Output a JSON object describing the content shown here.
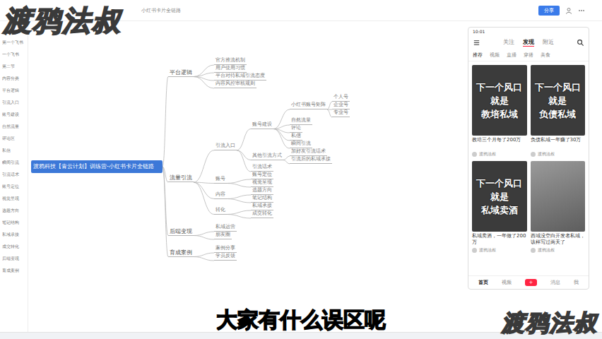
{
  "toolbar": {
    "doc_title": "小红书卡片全链路",
    "share_button": "分享"
  },
  "watermarks": [
    {
      "text": "渡鸦法叔"
    },
    {
      "text": "渡鸦法叔"
    }
  ],
  "sidebar": {
    "items": [
      "第一个飞书",
      "一个飞书",
      "第二节",
      "内容分类",
      "平台逻辑",
      "引流入口",
      "账号建设",
      "自然流量",
      "评论区",
      "私信",
      "瞬间引流",
      "引流话术",
      "账号定位",
      "视觉呈现",
      "选题方向",
      "笔记结构",
      "私域承接",
      "成交转化",
      "后端变现",
      "育成案例"
    ]
  },
  "mindmap": {
    "text": "渡鸦科技【青云计划】训练营-小红书卡片全链路",
    "children": [
      {
        "text": "平台逻辑",
        "children": [
          {
            "text": "官方推流机制"
          },
          {
            "text": "用户使用习惯"
          },
          {
            "text": "平台对待私域引流态度"
          },
          {
            "text": "内容风控审核规则"
          }
        ]
      },
      {
        "text": "流量引流",
        "children": [
          {
            "text": "引流入口",
            "children": [
              {
                "text": "账号建设",
                "children": [
                  {
                    "text": "小红书账号矩阵",
                    "children": [
                      {
                        "text": "个人号"
                      },
                      {
                        "text": "企业号"
                      },
                      {
                        "text": "专业号"
                      }
                    ]
                  },
                  {
                    "text": "自然流量"
                  },
                  {
                    "text": "评论"
                  },
                  {
                    "text": "私信"
                  },
                  {
                    "text": "瞬间引流"
                  }
                ]
              },
              {
                "text": "其他引流方式",
                "children": [
                  {
                    "text": "加好友引流话术"
                  },
                  {
                    "text": "引流后的私域承接"
                  }
                ]
              },
              {
                "text": "引流话术"
              }
            ]
          },
          {
            "text": "账号",
            "children": [
              {
                "text": "账号定位"
              },
              {
                "text": "视觉呈现"
              }
            ]
          },
          {
            "text": "内容",
            "children": [
              {
                "text": "选题方向"
              },
              {
                "text": "笔记结构"
              }
            ]
          },
          {
            "text": "转化",
            "children": [
              {
                "text": "私域承接"
              },
              {
                "text": "成交转化"
              }
            ]
          }
        ]
      },
      {
        "text": "后端变现",
        "children": [
          {
            "text": "私域运营"
          },
          {
            "text": "朋友圈"
          }
        ]
      },
      {
        "text": "育成案例",
        "children": [
          {
            "text": "案例分享"
          },
          {
            "text": "学员反馈"
          }
        ]
      }
    ]
  },
  "phone": {
    "time": "10:01",
    "tabs": [
      {
        "label": "关注",
        "selected": false
      },
      {
        "label": "发现",
        "selected": true
      },
      {
        "label": "附近",
        "selected": false
      }
    ],
    "categories": [
      {
        "label": "推荐",
        "selected": true
      },
      {
        "label": "视频",
        "selected": false
      },
      {
        "label": "直播",
        "selected": false
      },
      {
        "label": "穿搭",
        "selected": false
      },
      {
        "label": "美食",
        "selected": false
      }
    ],
    "cards": [
      {
        "cover": [
          "下一个风口",
          "就是",
          "教培私域"
        ],
        "caption": "教培三个月每了200万",
        "author": "渡鸦法叔"
      },
      {
        "cover": [
          "下一个风口",
          "就是",
          "负债私域"
        ],
        "caption": "负债私域一年赚了30万",
        "author": "渡鸦法叔"
      },
      {
        "cover": [
          "下一个风口",
          "就是",
          "私域卖酒"
        ],
        "caption": "私域卖酒，一年做了200万",
        "author": "渡鸦法叔"
      },
      {
        "cover": [],
        "caption": "西域没空白开发者私域，该样写过两天了",
        "author": "渡鸦法叔"
      }
    ],
    "nav": [
      {
        "label": "首页",
        "selected": true
      },
      {
        "label": "视频",
        "selected": false
      },
      {
        "label": "+",
        "selected": false
      },
      {
        "label": "消息",
        "selected": false
      },
      {
        "label": "我",
        "selected": false
      }
    ]
  },
  "subtitle": "大家有什么误区呢"
}
